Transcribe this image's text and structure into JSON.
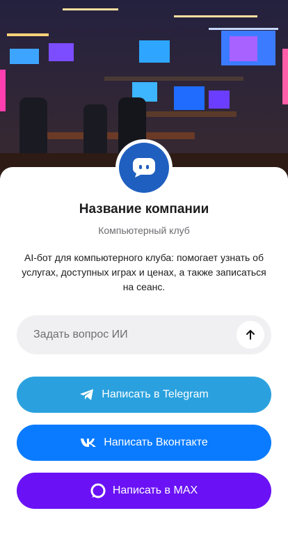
{
  "header": {
    "image_icon": "gaming-club-illustration"
  },
  "company": {
    "avatar_icon": "chat-bubble-icon",
    "name": "Название компании",
    "subtitle": "Компьютерный клуб",
    "description": "AI-бот для компьютерного клуба: помогает узнать об услугах, доступных играх и ценах, а также записаться на сеанс."
  },
  "ask": {
    "placeholder": "Задать вопрос ИИ",
    "value": "",
    "send_icon": "arrow-up-icon"
  },
  "actions": [
    {
      "label": "Написать в Telegram",
      "icon": "telegram-icon",
      "color": "#2AA1DE"
    },
    {
      "label": "Написать Вконтакте",
      "icon": "vk-icon",
      "color": "#0A7BFF"
    },
    {
      "label": "Написать в MAX",
      "icon": "max-icon",
      "color": "#6A12F5"
    }
  ]
}
